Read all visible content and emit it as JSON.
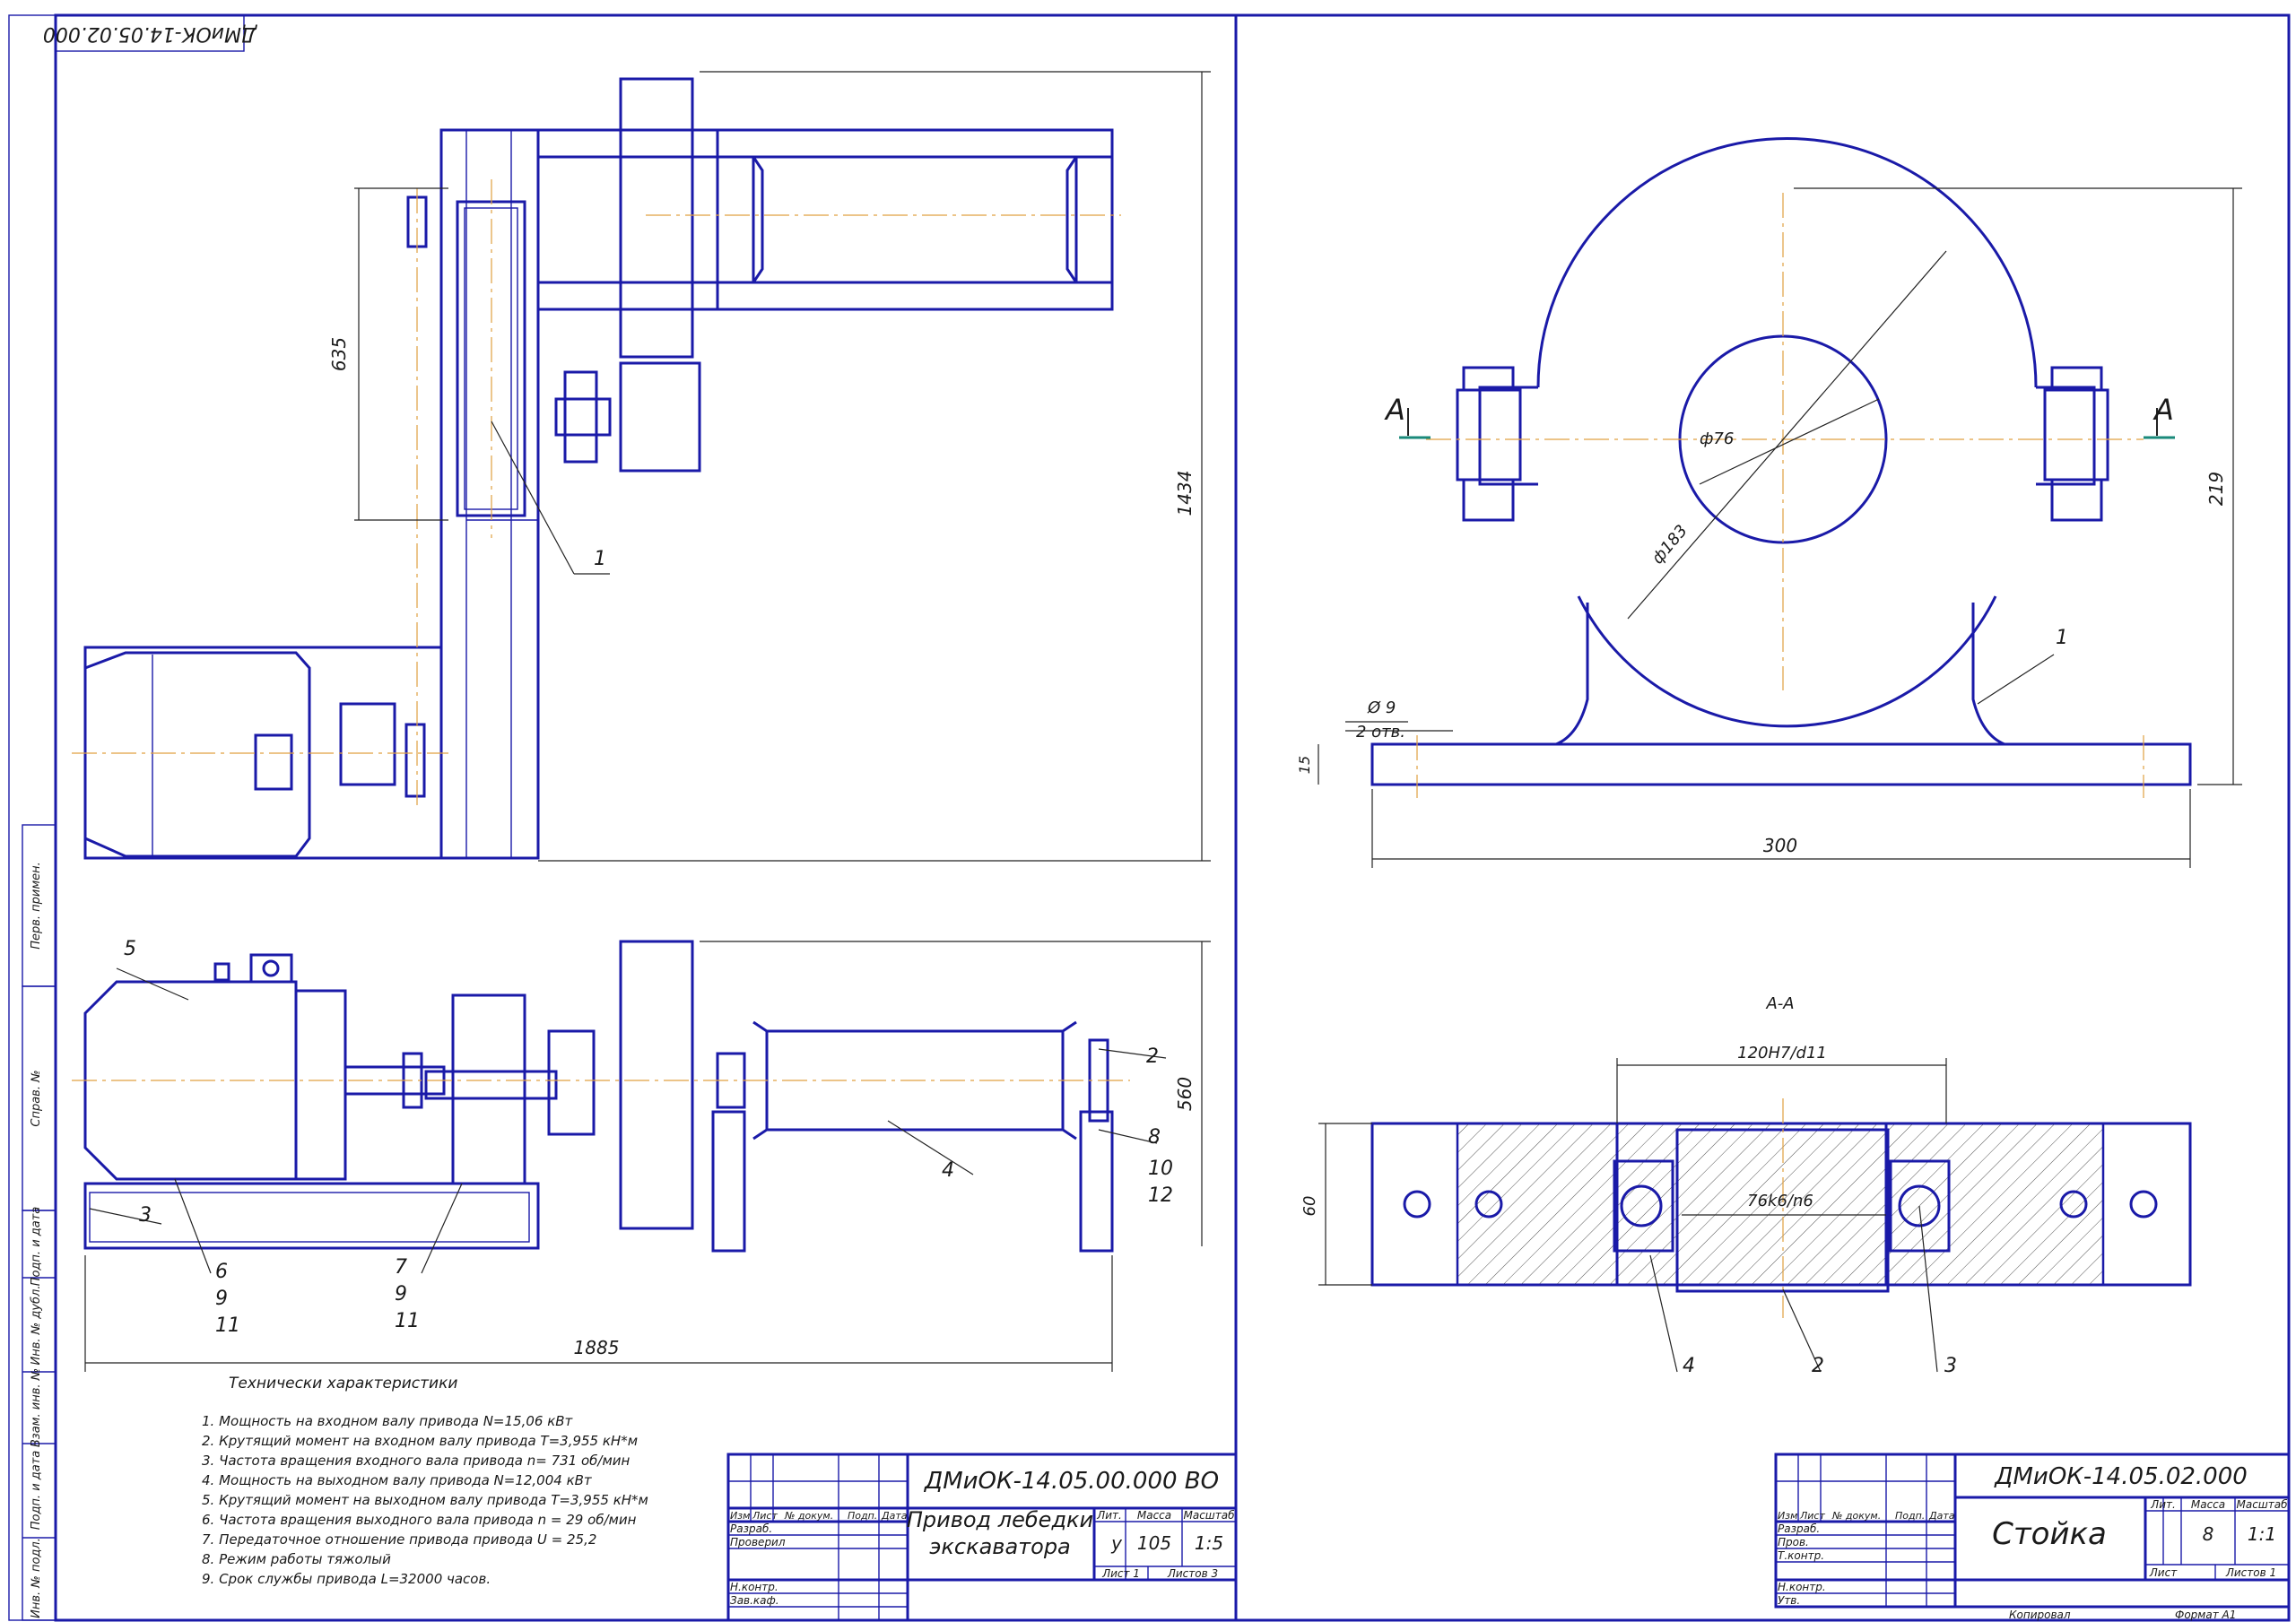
{
  "stamp_top": "ДМиОК-14.05.02.000",
  "side_stamps": [
    "Перв. примен.",
    "Справ. №",
    "Подп. и дата",
    "Инв. № дубл.",
    "Взам. инв. №",
    "Подп. и дата",
    "Инв. № подл."
  ],
  "left": {
    "dims": {
      "d635": "635",
      "d1434": "1434",
      "d560": "560",
      "d1885": "1885"
    },
    "callouts": {
      "c1": "1",
      "c2": "2",
      "c3": "3",
      "c4": "4",
      "c5": "5",
      "c6": "6",
      "c7": "7",
      "c8": "8",
      "c9a": "9",
      "c9b": "9",
      "c10": "10",
      "c11a": "11",
      "c11b": "11",
      "c12": "12"
    },
    "tech_title": "Технически характеристики",
    "tech_lines": [
      "1. Мощность на входном валу привода N=15,06 кВт",
      "2. Крутящий момент на входном валу привода T=3,955 кН*м",
      "3. Частота вращения входного вала привода  n= 731 об/мин",
      "4. Мощность на выходном валу привода N=12,004 кВт",
      "5. Крутящий момент на выходном валу привода T=3,955 кН*м",
      "6. Частота вращения выходного вала привода n = 29 об/мин",
      "7. Передаточное отношение привода привода U = 25,2",
      "8. Режим работы тяжолый",
      "9. Срок службы привода L=32000 часов."
    ]
  },
  "right": {
    "section_mark": "A",
    "section_title": "А-А",
    "dims": {
      "phi76": "ф76",
      "phi183": "ф183",
      "d219": "219",
      "d15": "15",
      "d300": "300",
      "hole": "Ø 9",
      "holes": "2 отв.",
      "fit1": "120H7/d11",
      "fit2": "76k6/n6",
      "d60": "60"
    },
    "callouts": {
      "c1": "1",
      "c2": "2",
      "c3": "3",
      "c4": "4"
    }
  },
  "title_block_left": {
    "code": "ДМиОК-14.05.00.000 ВО",
    "name_line1": "Привод лебедки",
    "name_line2": "экскаватора",
    "hdr": [
      "Изм",
      "Лист",
      "№ докум.",
      "Подп.",
      "Дата"
    ],
    "roles": [
      "Разраб.",
      "Проверил",
      "Н.контр.",
      "Зав.каф."
    ],
    "lit_label": "Лит.",
    "mass_label": "Масса",
    "scale_label": "Масштаб",
    "lit": "у",
    "mass": "105",
    "scale": "1:5",
    "sheet": "Лист 1",
    "sheets": "Листов 3"
  },
  "title_block_right": {
    "code": "ДМиОК-14.05.02.000",
    "name": "Стойка",
    "hdr": [
      "Изм",
      "Лист",
      "№ докум.",
      "Подп.",
      "Дата"
    ],
    "roles": [
      "Разраб.",
      "Пров.",
      "Т.контр.",
      "Н.контр.",
      "Утв."
    ],
    "lit_label": "Лит.",
    "mass_label": "Масса",
    "scale_label": "Масштаб",
    "mass": "8",
    "scale": "1:1",
    "sheet": "Лист",
    "sheets": "Листов   1",
    "copied": "Копировал",
    "format": "Формат    А1"
  }
}
